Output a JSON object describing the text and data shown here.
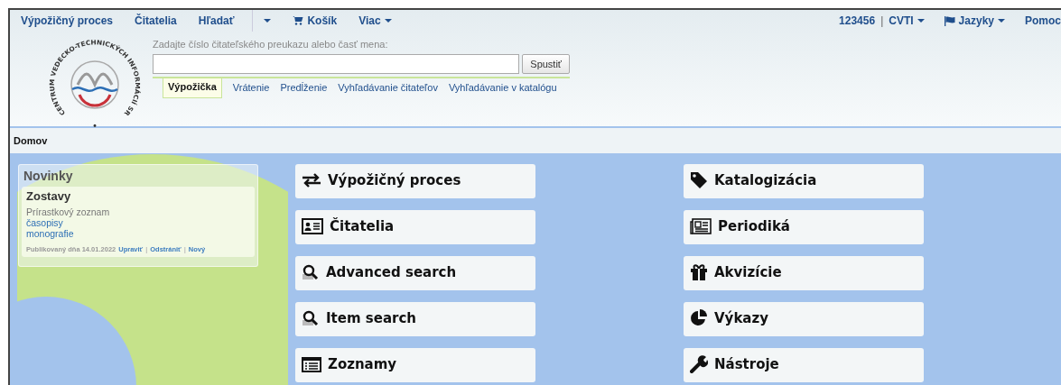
{
  "top_nav": {
    "left": [
      {
        "label": "Výpožičný proces",
        "kind": "link"
      },
      {
        "label": "Čitatelia",
        "kind": "link"
      },
      {
        "label": "Hľadať",
        "kind": "link"
      },
      {
        "kind": "caret"
      },
      {
        "label": "Košík",
        "kind": "cart"
      },
      {
        "label": "Viac",
        "kind": "dropdown"
      }
    ],
    "user": "123456",
    "separator": "|",
    "library": "CVTI",
    "languages": "Jazyky",
    "help": "Pomoc"
  },
  "logo": {
    "text": "CENTRUM VEDECKO-TECHNICKÝCH INFORMÁCIÍ SR",
    "bullet": "•"
  },
  "search": {
    "label": "Zadajte číslo čitateľského preukazu alebo časť mena:",
    "button": "Spustiť"
  },
  "search_tabs": [
    {
      "label": "Výpožička",
      "selected": true
    },
    {
      "label": "Vrátenie",
      "selected": false
    },
    {
      "label": "Predĺženie",
      "selected": false
    },
    {
      "label": "Vyhľadávanie čitateľov",
      "selected": false
    },
    {
      "label": "Vyhľadávanie v katalógu",
      "selected": false
    }
  ],
  "breadcrumb": "Domov",
  "news": {
    "title": "Novinky",
    "item": {
      "title": "Zostavy",
      "lines": [
        {
          "text": "Prírastkový zoznam",
          "link": false
        },
        {
          "text": "časopisy",
          "link": true
        },
        {
          "text": "monografie",
          "link": true
        }
      ],
      "published": "Publikovaný dňa 14.01.2022",
      "actions": [
        "Upraviť",
        "Odstrániť",
        "Nový"
      ],
      "action_separator": "|"
    }
  },
  "tiles": [
    {
      "label": "Výpožičný proces",
      "kind": "loans"
    },
    {
      "label": "Katalogizácia",
      "kind": "cataloguing"
    },
    {
      "label": "Čitatelia",
      "kind": "readers"
    },
    {
      "label": "Periodiká",
      "kind": "periodicals"
    },
    {
      "label": "Advanced search",
      "kind": "search"
    },
    {
      "label": "Akvizície",
      "kind": "acquisitions"
    },
    {
      "label": "Item search",
      "kind": "search"
    },
    {
      "label": "Výkazy",
      "kind": "reports"
    },
    {
      "label": "Zoznamy",
      "kind": "lists"
    },
    {
      "label": "Nástroje",
      "kind": "tools"
    }
  ]
}
